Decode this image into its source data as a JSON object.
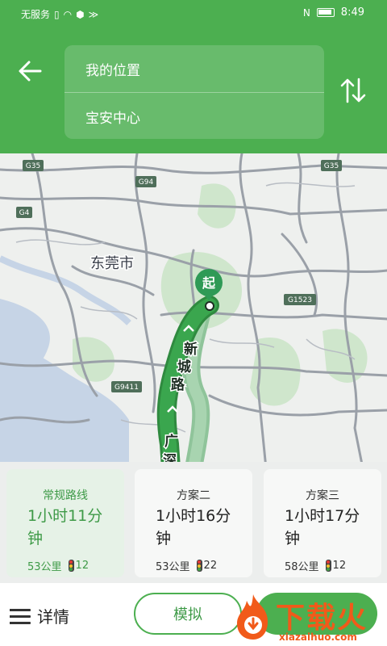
{
  "status_bar": {
    "carrier": "无服务",
    "time": "8:49"
  },
  "header": {
    "origin": "我的位置",
    "destination": "宝安中心"
  },
  "map": {
    "city_label": "东莞市",
    "start_marker": "起",
    "highways": [
      "G35",
      "G94",
      "G4",
      "G35",
      "G1523",
      "G9411"
    ],
    "route_road_names": [
      "新",
      "城",
      "路",
      "广",
      "深"
    ]
  },
  "plans": [
    {
      "label": "常规路线",
      "time": "1小时11分钟",
      "distance": "53公里",
      "lights": "12",
      "selected": true
    },
    {
      "label": "方案二",
      "time": "1小时16分钟",
      "distance": "53公里",
      "lights": "22",
      "selected": false
    },
    {
      "label": "方案三",
      "time": "1小时17分钟",
      "distance": "58公里",
      "lights": "12",
      "selected": false
    }
  ],
  "bottom_bar": {
    "details_label": "详情",
    "simulate_label": "模拟"
  },
  "watermark": {
    "text": "下载火",
    "sub": "xiazaihuo.com"
  },
  "colors": {
    "primary": "#4caf50",
    "selected_text": "#3e9a47",
    "watermark": "#f15a1a"
  }
}
